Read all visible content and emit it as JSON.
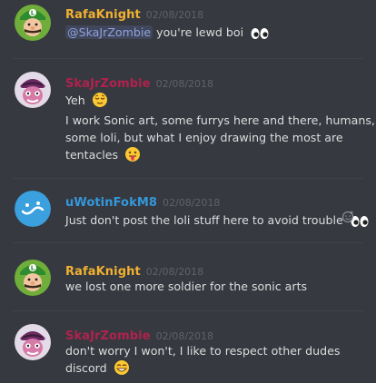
{
  "messages": [
    {
      "username": "RafaKnight",
      "color": "#f0b132",
      "timestamp": "02/08/2018",
      "mention": "@SkaJrZombie",
      "lines": [
        " you're lewd boi"
      ]
    },
    {
      "username": "SkaJrZombie",
      "color": "#b0224e",
      "timestamp": "02/08/2018",
      "lines": [
        "Yeh",
        "I work Sonic art, some furrys here and there, humans,",
        "some loli, but what I enjoy drawing the most are",
        "tentacles"
      ]
    },
    {
      "username": "uWotinFokM8",
      "color": "#3498db",
      "timestamp": "02/08/2018",
      "lines": [
        "Just don't post the loli stuff here to avoid trouble"
      ]
    },
    {
      "username": "RafaKnight",
      "color": "#f0b132",
      "timestamp": "02/08/2018",
      "lines": [
        "we lost one more soldier for the sonic arts"
      ]
    },
    {
      "username": "SkaJrZombie",
      "color": "#b0224e",
      "timestamp": "02/08/2018",
      "lines": [
        "don't worry I won't, I like to respect other dudes",
        "discord"
      ]
    }
  ],
  "icons": {
    "eyes": "eyes-emoji",
    "relieved": "relieved-emoji",
    "tongue": "tongue-out-emoji",
    "grin": "grin-emoji",
    "add_reaction": "add-reaction-icon"
  }
}
